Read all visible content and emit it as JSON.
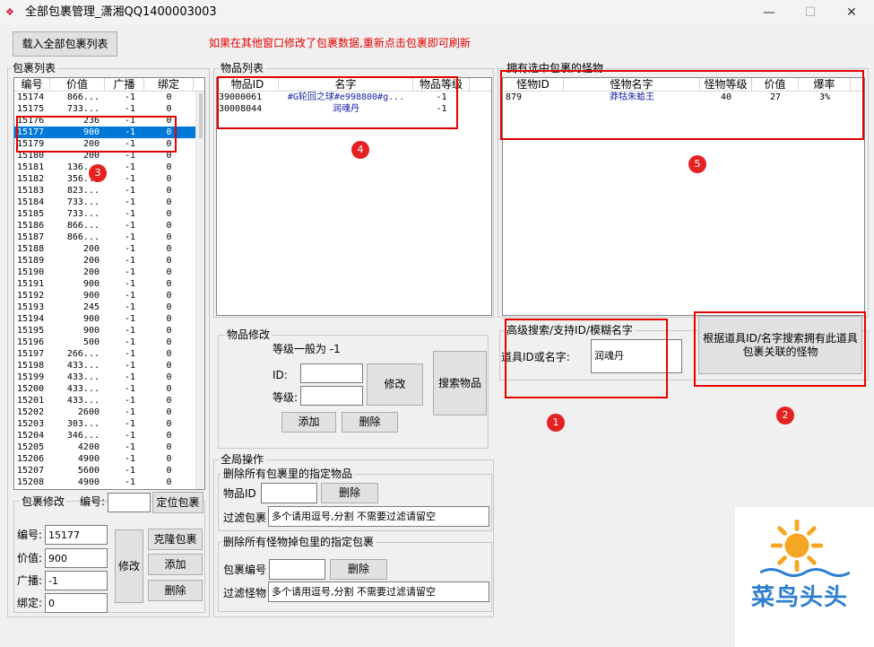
{
  "window": {
    "title": "全部包裹管理_潇湘QQ1400003003",
    "minimize": "—",
    "maximize": "☐",
    "close": "✕"
  },
  "toolbar": {
    "load_label": "载入全部包裹列表",
    "notice": "如果在其他窗口修改了包裹数据,重新点击包裹即可刷新"
  },
  "package_list": {
    "title": "包裹列表",
    "columns": [
      "编号",
      "价值",
      "广播",
      "绑定"
    ],
    "rows": [
      [
        "15174",
        "866...",
        "-1",
        "0"
      ],
      [
        "15175",
        "733...",
        "-1",
        "0"
      ],
      [
        "15176",
        "236",
        "-1",
        "0"
      ],
      [
        "15177",
        "900",
        "-1",
        "0"
      ],
      [
        "15179",
        "200",
        "-1",
        "0"
      ],
      [
        "15180",
        "200",
        "-1",
        "0"
      ],
      [
        "15181",
        "136...",
        "-1",
        "0"
      ],
      [
        "15182",
        "356...",
        "-1",
        "0"
      ],
      [
        "15183",
        "823...",
        "-1",
        "0"
      ],
      [
        "15184",
        "733...",
        "-1",
        "0"
      ],
      [
        "15185",
        "733...",
        "-1",
        "0"
      ],
      [
        "15186",
        "866...",
        "-1",
        "0"
      ],
      [
        "15187",
        "866...",
        "-1",
        "0"
      ],
      [
        "15188",
        "200",
        "-1",
        "0"
      ],
      [
        "15189",
        "200",
        "-1",
        "0"
      ],
      [
        "15190",
        "200",
        "-1",
        "0"
      ],
      [
        "15191",
        "900",
        "-1",
        "0"
      ],
      [
        "15192",
        "900",
        "-1",
        "0"
      ],
      [
        "15193",
        "245",
        "-1",
        "0"
      ],
      [
        "15194",
        "900",
        "-1",
        "0"
      ],
      [
        "15195",
        "900",
        "-1",
        "0"
      ],
      [
        "15196",
        "500",
        "-1",
        "0"
      ],
      [
        "15197",
        "266...",
        "-1",
        "0"
      ],
      [
        "15198",
        "433...",
        "-1",
        "0"
      ],
      [
        "15199",
        "433...",
        "-1",
        "0"
      ],
      [
        "15200",
        "433...",
        "-1",
        "0"
      ],
      [
        "15201",
        "433...",
        "-1",
        "0"
      ],
      [
        "15202",
        "2600",
        "-1",
        "0"
      ],
      [
        "15203",
        "303...",
        "-1",
        "0"
      ],
      [
        "15204",
        "346...",
        "-1",
        "0"
      ],
      [
        "15205",
        "4200",
        "-1",
        "0"
      ],
      [
        "15206",
        "4900",
        "-1",
        "0"
      ],
      [
        "15207",
        "5600",
        "-1",
        "0"
      ],
      [
        "15208",
        "4900",
        "-1",
        "0"
      ]
    ]
  },
  "package_edit": {
    "title": "包裹修改",
    "id_label": "编号:",
    "locate": "定位包裹",
    "num_label": "编号:",
    "num_value": "15177",
    "value_label": "价值:",
    "value_value": "900",
    "broadcast_label": "广播:",
    "broadcast_value": "-1",
    "bind_label": "绑定:",
    "bind_value": "0",
    "modify": "修改",
    "clone": "克隆包裹",
    "add": "添加",
    "delete": "删除"
  },
  "item_list": {
    "title": "物品列表",
    "columns": [
      "物品ID",
      "名字",
      "物品等级"
    ],
    "rows": [
      [
        "39000061",
        "#G轮回之球#e998800#g...",
        "-1"
      ],
      [
        "30008044",
        "润魂丹",
        "-1"
      ]
    ]
  },
  "item_edit": {
    "title": "物品修改",
    "note": "等级一般为 -1",
    "id_label": "ID:",
    "level_label": "等级:",
    "modify": "修改",
    "search": "搜索物品",
    "add": "添加",
    "delete": "删除"
  },
  "global_ops": {
    "title": "全局操作",
    "del_item_title": "删除所有包裹里的指定物品",
    "item_id_label": "物品ID",
    "delete1": "删除",
    "filter_pkg_label": "过滤包裹",
    "filter_pkg_value": "多个请用逗号,分割 不需要过滤请留空",
    "del_pkg_title": "删除所有怪物掉包里的指定包裹",
    "pkg_id_label": "包裹编号",
    "delete2": "删除",
    "filter_mon_label": "过滤怪物",
    "filter_mon_value": "多个请用逗号,分割 不需要过滤请留空"
  },
  "monster_list": {
    "title": "拥有选中包裹的怪物",
    "columns": [
      "怪物ID",
      "怪物名字",
      "怪物等级",
      "价值",
      "爆率"
    ],
    "rows": [
      [
        "879",
        "莽牯朱蛤王",
        "40",
        "27",
        "3%"
      ]
    ]
  },
  "advanced": {
    "title": "高级搜索/支持ID/模糊名字",
    "label": "道具ID或名字:",
    "value": "润魂丹",
    "search_button": "根据道具ID/名字搜索拥有此道具包裹关联的怪物"
  },
  "annotations": {
    "b1": "1",
    "b2": "2",
    "b3": "3",
    "b4": "4",
    "b5": "5"
  },
  "logo": {
    "text": "菜鸟头头"
  },
  "colors": {
    "accent": "#0078d7",
    "annotation": "#e60000",
    "notice": "#e60000",
    "logo": "#2d7fd1",
    "sun": "#f5a623"
  }
}
